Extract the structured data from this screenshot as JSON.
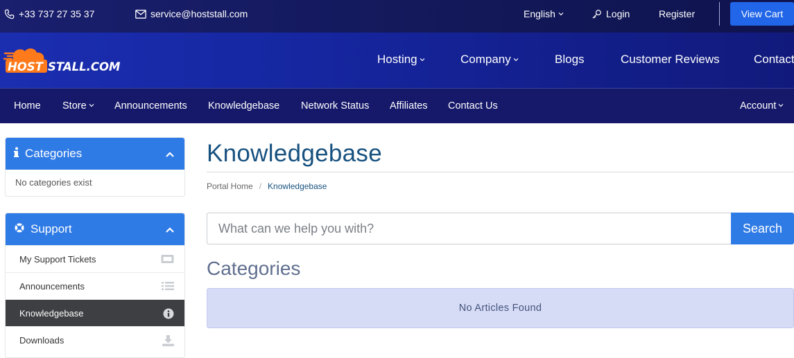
{
  "topbar": {
    "phone": "+33 737 27 35 37",
    "email": "service@hoststall.com",
    "language": "English",
    "login": "Login",
    "register": "Register",
    "view_cart": "View Cart"
  },
  "logo": {
    "text_left": "HOST",
    "text_right": "STALL.COM"
  },
  "main_nav": {
    "hosting": "Hosting",
    "company": "Company",
    "blogs": "Blogs",
    "reviews": "Customer Reviews",
    "contact": "Contact"
  },
  "sub_nav": {
    "home": "Home",
    "store": "Store",
    "announcements": "Announcements",
    "knowledgebase": "Knowledgebase",
    "network_status": "Network Status",
    "affiliates": "Affiliates",
    "contact_us": "Contact Us",
    "account": "Account"
  },
  "sidebar": {
    "categories": {
      "title": "Categories",
      "empty": "No categories exist"
    },
    "support": {
      "title": "Support",
      "items": [
        {
          "label": "My Support Tickets",
          "icon": "ticket-icon"
        },
        {
          "label": "Announcements",
          "icon": "list-icon"
        },
        {
          "label": "Knowledgebase",
          "icon": "info-icon",
          "active": true
        },
        {
          "label": "Downloads",
          "icon": "download-icon"
        }
      ]
    }
  },
  "main": {
    "title": "Knowledgebase",
    "breadcrumb": {
      "home": "Portal Home",
      "sep": "/",
      "current": "Knowledgebase"
    },
    "search": {
      "placeholder": "What can we help you with?",
      "button": "Search"
    },
    "categories_title": "Categories",
    "no_articles": "No Articles Found"
  },
  "colors": {
    "topbar": "#1a1f6e",
    "header": "#1627a2",
    "subnav": "#16196a",
    "accent": "#2f7be6",
    "title": "#17517f",
    "alert_bg": "#d6dbf6"
  }
}
